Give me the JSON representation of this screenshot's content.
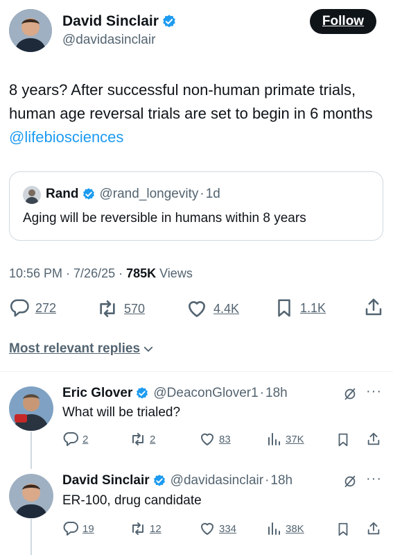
{
  "tweet": {
    "author_name": "David Sinclair",
    "author_handle": "@davidasinclair",
    "follow_label": "Follow",
    "text": "8 years? After successful non-human primate trials, human age reversal trials are set to begin in 6 months ",
    "mention": "@lifebiosciences",
    "quote": {
      "author_name": "Rand",
      "author_handle": "@rand_longevity",
      "dot": "·",
      "time": "1d",
      "text": "Aging will be reversible in humans within 8 years"
    },
    "timestamp": "10:56 PM · 7/26/25 · ",
    "views_count": "785K",
    "views_label": " Views",
    "stats": {
      "replies": "272",
      "reposts": "570",
      "likes": "4.4K",
      "bookmarks": "1.1K"
    }
  },
  "replies_header": "Most relevant replies",
  "replies": [
    {
      "author_name": "Eric Glover",
      "author_handle": "@DeaconGlover1",
      "dot": "·",
      "time": "18h",
      "text": "What will be trialed?",
      "stats": {
        "replies": "2",
        "reposts": "2",
        "likes": "83",
        "views": "37K"
      }
    },
    {
      "author_name": "David Sinclair",
      "author_handle": "@davidasinclair",
      "dot": "·",
      "time": "18h",
      "text": "ER-100, drug candidate",
      "stats": {
        "replies": "19",
        "reposts": "12",
        "likes": "334",
        "views": "38K"
      }
    }
  ],
  "colors": {
    "verified": "#1d9bf0",
    "link": "#1d9bf0",
    "muted": "#536471",
    "text": "#0f1419"
  }
}
